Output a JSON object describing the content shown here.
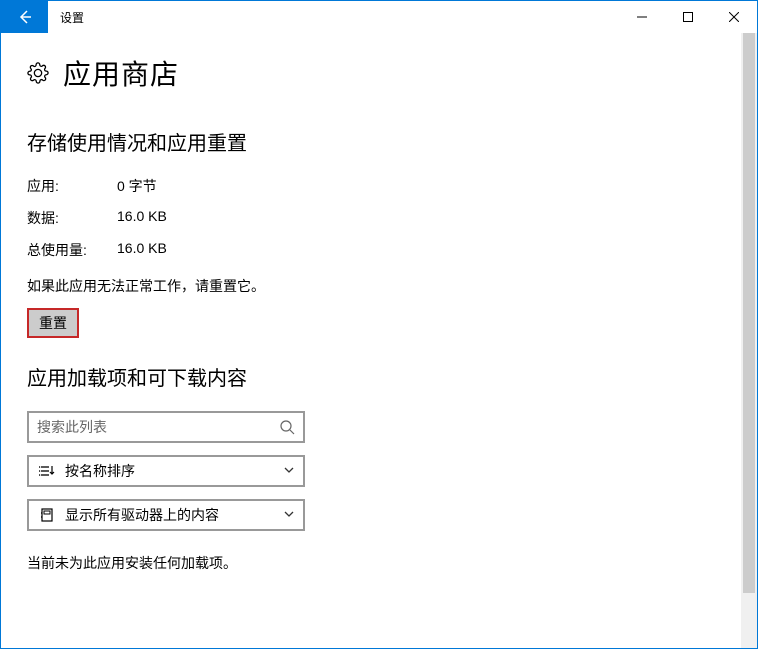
{
  "window": {
    "title": "设置"
  },
  "page": {
    "title": "应用商店"
  },
  "storage": {
    "section_title": "存储使用情况和应用重置",
    "rows": [
      {
        "label": "应用:",
        "value": "0 字节"
      },
      {
        "label": "数据:",
        "value": "16.0 KB"
      },
      {
        "label": "总使用量:",
        "value": "16.0 KB"
      }
    ],
    "reset_hint": "如果此应用无法正常工作，请重置它。",
    "reset_label": "重置"
  },
  "addons": {
    "section_title": "应用加载项和可下载内容",
    "search_placeholder": "搜索此列表",
    "sort_label": "按名称排序",
    "filter_label": "显示所有驱动器上的内容",
    "empty_text": "当前未为此应用安装任何加载项。"
  }
}
